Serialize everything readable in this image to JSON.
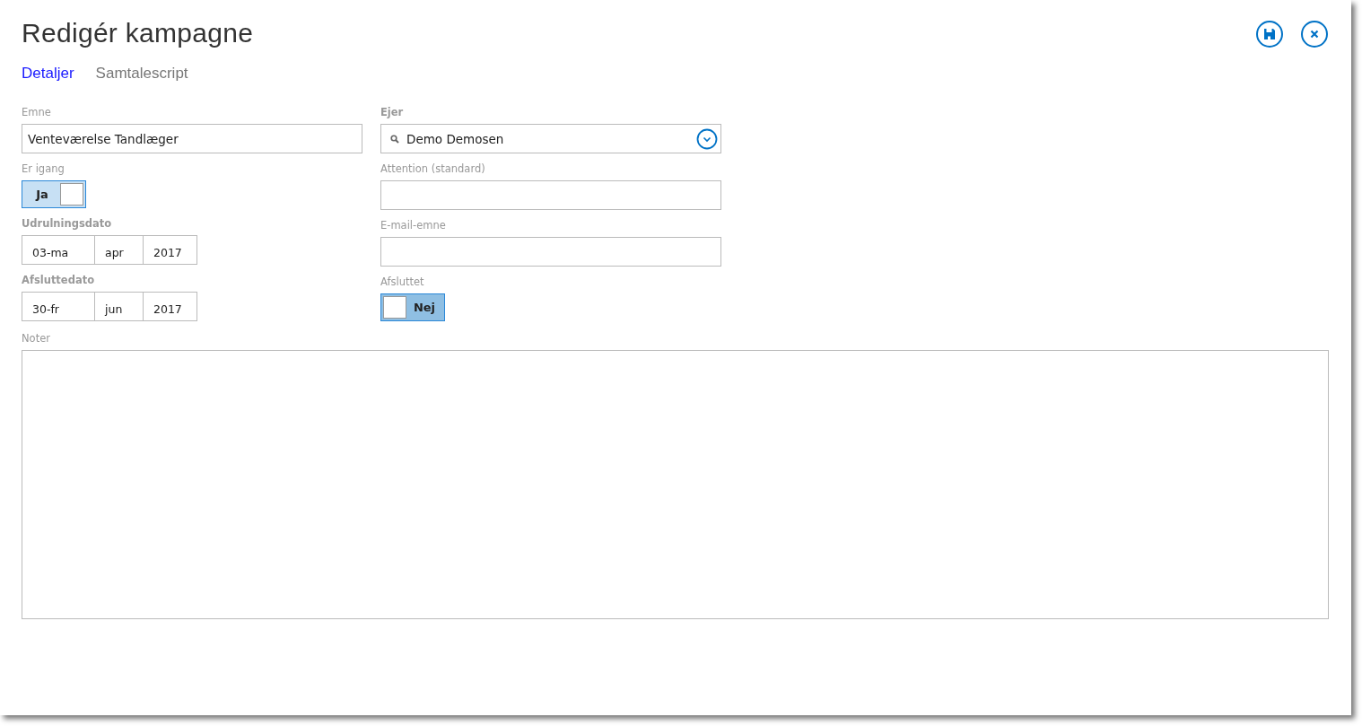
{
  "title": "Redigér kampagne",
  "tabs": [
    {
      "label": "Detaljer",
      "selected": true
    },
    {
      "label": "Samtalescript",
      "selected": false
    }
  ],
  "left_fields": [
    {
      "kind": "text",
      "label": "Emne",
      "required": false,
      "value": "Venteværelse Tandlæger"
    },
    {
      "kind": "toggle",
      "label": "Er igang",
      "required": false,
      "on": true,
      "text": "Ja"
    },
    {
      "kind": "date",
      "label": "Udrulningsdato",
      "required": true,
      "parts": [
        "03-ma",
        "apr",
        "2017"
      ]
    },
    {
      "kind": "date",
      "label": "Afsluttedato",
      "required": true,
      "parts": [
        "30-fr",
        "jun",
        "2017"
      ]
    }
  ],
  "right_fields": [
    {
      "kind": "lookup",
      "label": "Ejer",
      "required": true,
      "value": "Demo Demosen"
    },
    {
      "kind": "text",
      "label": "Attention (standard)",
      "required": false
    },
    {
      "kind": "text",
      "label": "E-mail-emne",
      "required": false
    },
    {
      "kind": "toggle",
      "label": "Afsluttet",
      "required": false,
      "on": false,
      "text": "Nej"
    }
  ],
  "notes": {
    "label": "Noter"
  }
}
